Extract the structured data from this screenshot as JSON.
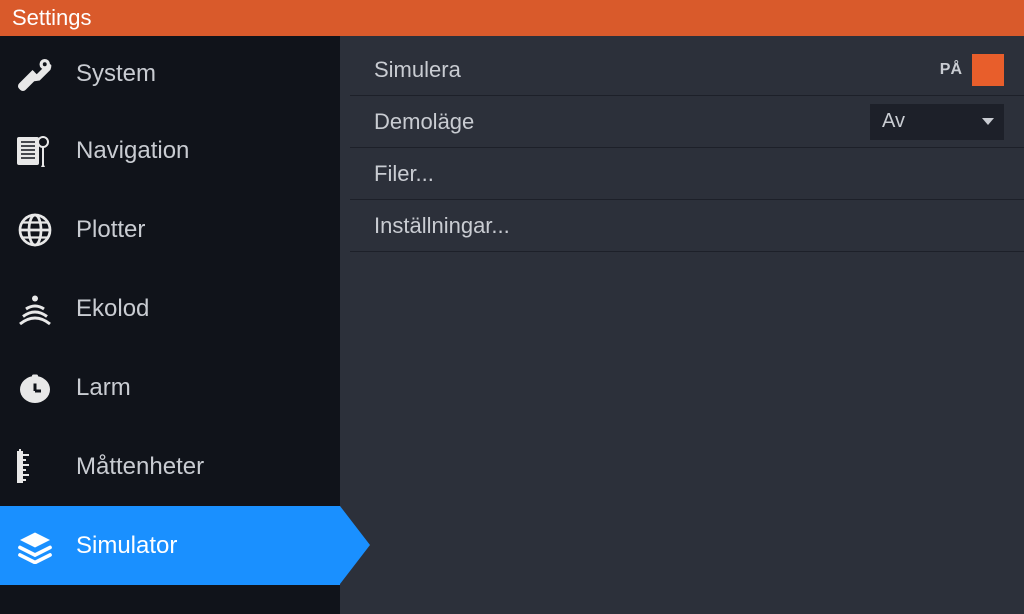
{
  "title": "Settings",
  "sidebar": {
    "items": [
      {
        "label": "System"
      },
      {
        "label": "Navigation"
      },
      {
        "label": "Plotter"
      },
      {
        "label": "Ekolod"
      },
      {
        "label": "Larm"
      },
      {
        "label": "Måttenheter"
      },
      {
        "label": "Simulator"
      }
    ]
  },
  "content": {
    "simulate": {
      "label": "Simulera",
      "state": "PÅ"
    },
    "demo": {
      "label": "Demoläge",
      "value": "Av"
    },
    "files": {
      "label": "Filer..."
    },
    "settings": {
      "label": "Inställningar..."
    }
  }
}
